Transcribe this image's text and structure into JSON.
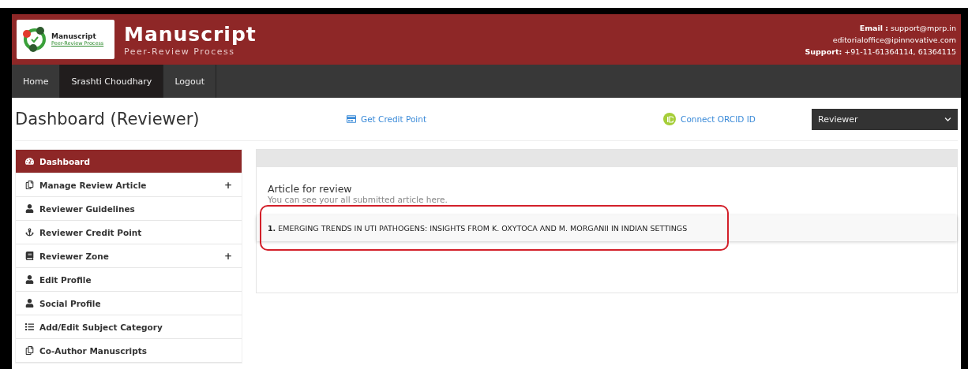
{
  "header": {
    "logo_title": "Manuscript",
    "logo_subtitle": "Peer-Review Process",
    "title": "Manuscript",
    "subtitle": "Peer-Review Process",
    "contact": [
      "**Email :** support@mprp.in",
      "editorialoffice@ipinnovative.com",
      "**Support:** +91-11-61364114, 61364115"
    ]
  },
  "nav": [
    {
      "label": "Home",
      "selected": false
    },
    {
      "label": "Srashti Choudhary",
      "selected": true
    },
    {
      "label": "Logout",
      "selected": false
    }
  ],
  "page_title": "Dashboard (Reviewer)",
  "actions": [
    {
      "kind": "card",
      "label": "Get Credit Point"
    },
    {
      "kind": "orcid",
      "label": "Connect ORCID ID"
    }
  ],
  "role_select": {
    "value": "Reviewer"
  },
  "sidebar": [
    {
      "kind": "gauge",
      "label": "Dashboard",
      "selected": true
    },
    {
      "kind": "copy",
      "label": "Manage Review Article",
      "selected": false,
      "expander": "+"
    },
    {
      "kind": "user",
      "label": "Reviewer Guidelines",
      "selected": false
    },
    {
      "kind": "anchor",
      "label": "Reviewer Credit Point",
      "selected": false
    },
    {
      "kind": "book",
      "label": "Reviewer Zone",
      "selected": false,
      "expander": "+"
    },
    {
      "kind": "user",
      "label": "Edit Profile",
      "selected": false
    },
    {
      "kind": "user",
      "label": "Social Profile",
      "selected": false
    },
    {
      "kind": "list",
      "label": "Add/Edit Subject Category",
      "selected": false
    },
    {
      "kind": "copy",
      "label": "Co-Author Manuscripts",
      "selected": false
    }
  ],
  "panel": {
    "title": "Article for review",
    "subtitle": "You can see your all submitted article here.",
    "articles": [
      {
        "number": "1.",
        "title": "EMERGING TRENDS IN UTI PATHOGENS: INSIGHTS FROM K. OXYTOCA AND M. MORGANII IN INDIAN SETTINGS",
        "highlighted": true
      }
    ]
  }
}
